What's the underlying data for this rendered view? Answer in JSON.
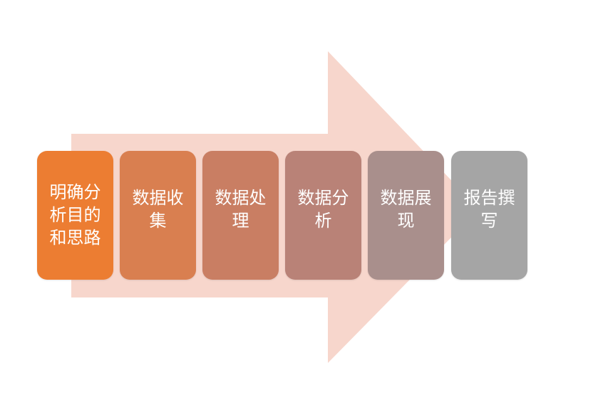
{
  "diagram": {
    "arrow_color": "#f7d6cc",
    "steps": [
      {
        "label": "明确分析目的和思路",
        "color": "#ec7d32"
      },
      {
        "label": "数据收集",
        "color": "#d97f50"
      },
      {
        "label": "数据处理",
        "color": "#c97e63"
      },
      {
        "label": "数据分析",
        "color": "#b98277"
      },
      {
        "label": "数据展现",
        "color": "#a98f8c"
      },
      {
        "label": "报告撰写",
        "color": "#a5a5a5"
      }
    ]
  }
}
